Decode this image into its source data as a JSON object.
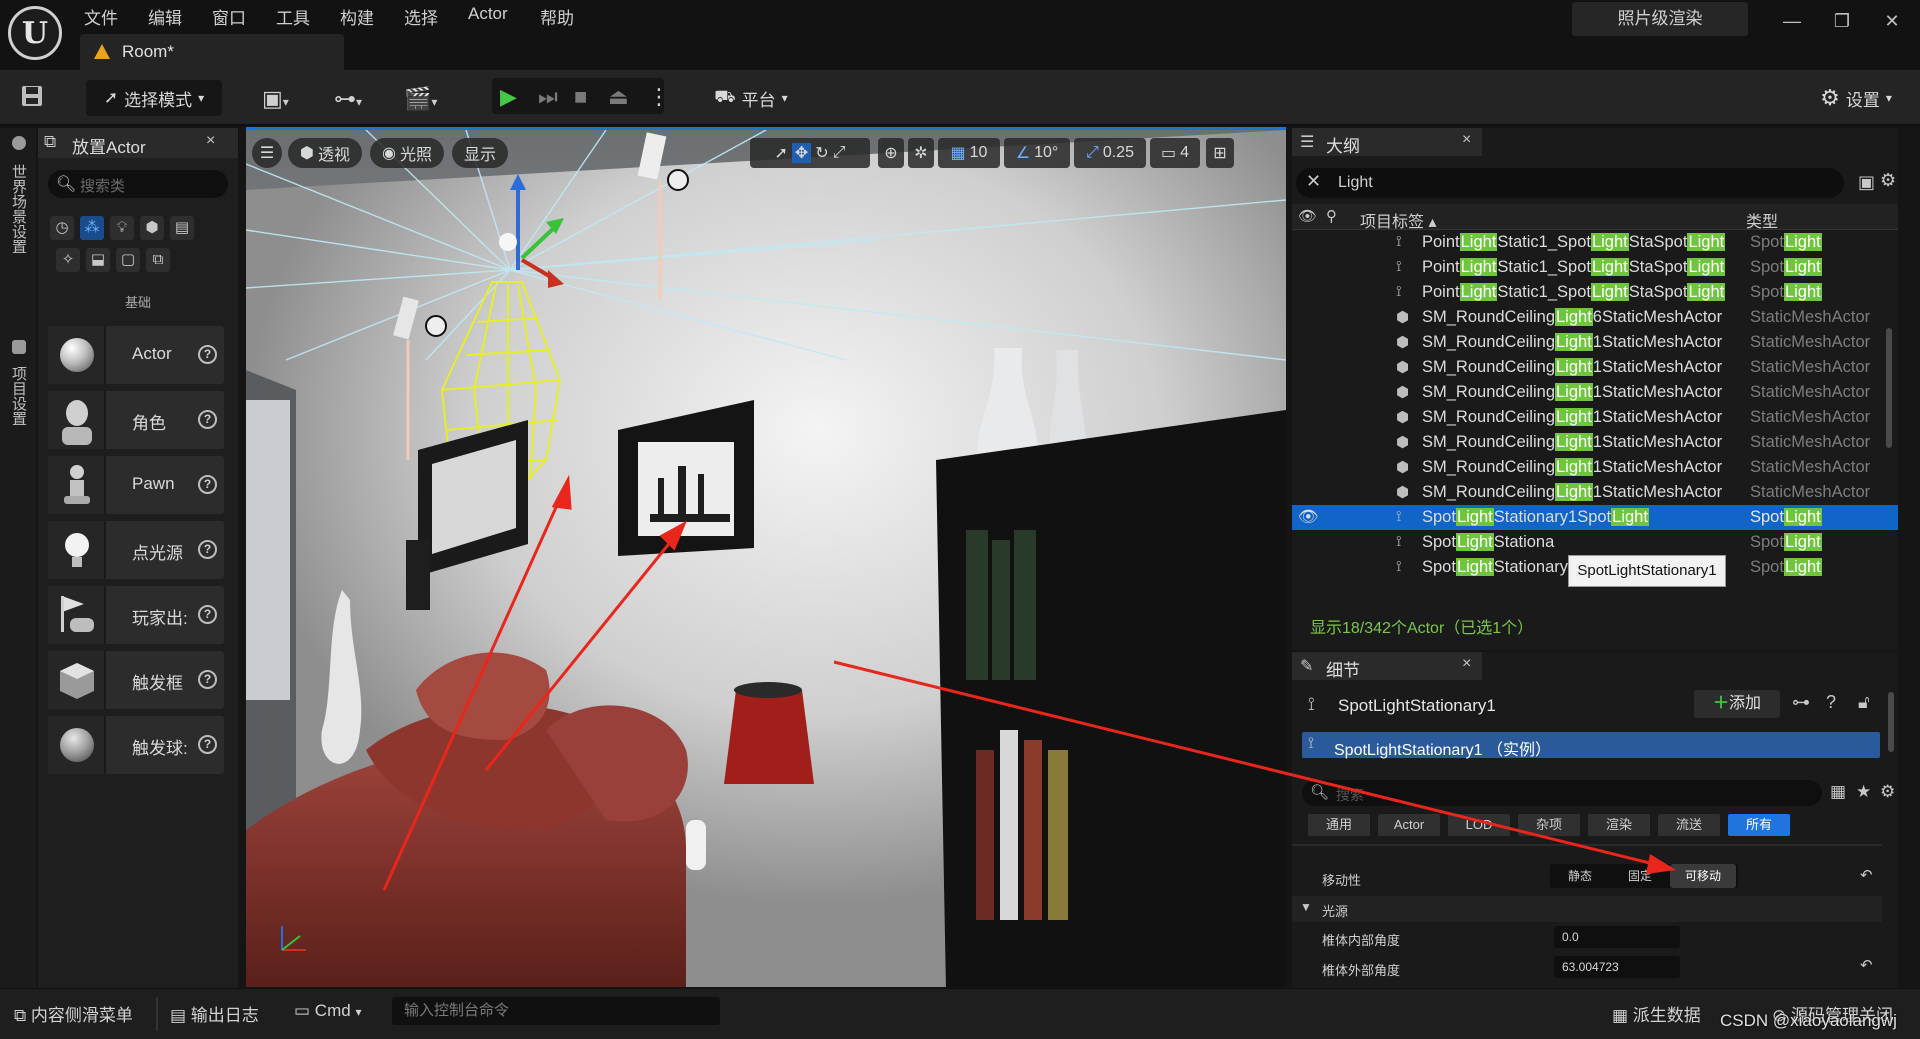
{
  "menu": {
    "items": [
      "文件",
      "编辑",
      "窗口",
      "工具",
      "构建",
      "选择",
      "Actor",
      "帮助"
    ],
    "render_mode": "照片级渲染",
    "logo_letter": "U",
    "window_controls": [
      "—",
      "❐",
      "✕"
    ]
  },
  "doc_tab": {
    "name": "Room*"
  },
  "toolbar": {
    "select_mode": "选择模式",
    "platform": "平台",
    "settings": "设置"
  },
  "left_strip": {
    "item1": "世界场景设置",
    "item2": "项目设置"
  },
  "place_panel": {
    "title": "放置Actor",
    "search_placeholder": "搜索类",
    "category": "基础",
    "items": [
      {
        "label": "Actor"
      },
      {
        "label": "角色"
      },
      {
        "label": "Pawn"
      },
      {
        "label": "点光源"
      },
      {
        "label": "玩家出:"
      },
      {
        "label": "触发框"
      },
      {
        "label": "触发球:"
      }
    ]
  },
  "viewport": {
    "perspective": "透视",
    "lit": "光照",
    "show": "显示",
    "grid_snap": "10",
    "rotation_snap": "10°",
    "scale_snap": "0.25",
    "camera_speed": "4"
  },
  "outliner": {
    "title": "大纲",
    "filter": "Light",
    "col_label": "项目标签",
    "col_type": "类型",
    "rows": [
      {
        "pre": "Point",
        "hl": "Light",
        "post": "Static1_Spot",
        "hl2": "Light",
        "post2": "StaSpot",
        "hl3": "Light",
        "type_pre": "Spot",
        "type_hl": "Light"
      },
      {
        "pre": "Point",
        "hl": "Light",
        "post": "Static1_Spot",
        "hl2": "Light",
        "post2": "StaSpot",
        "hl3": "Light",
        "type_pre": "Spot",
        "type_hl": "Light"
      },
      {
        "pre": "Point",
        "hl": "Light",
        "post": "Static1_Spot",
        "hl2": "Light",
        "post2": "StaSpot",
        "hl3": "Light",
        "type_pre": "Spot",
        "type_hl": "Light"
      },
      {
        "pre": "SM_RoundCeiling",
        "hl": "Light",
        "post": "6StaticMeshActor",
        "type": "StaticMeshActor"
      },
      {
        "pre": "SM_RoundCeiling",
        "hl": "Light",
        "post": "1StaticMeshActor",
        "type": "StaticMeshActor"
      },
      {
        "pre": "SM_RoundCeiling",
        "hl": "Light",
        "post": "1StaticMeshActor",
        "type": "StaticMeshActor"
      },
      {
        "pre": "SM_RoundCeiling",
        "hl": "Light",
        "post": "1StaticMeshActor",
        "type": "StaticMeshActor"
      },
      {
        "pre": "SM_RoundCeiling",
        "hl": "Light",
        "post": "1StaticMeshActor",
        "type": "StaticMeshActor"
      },
      {
        "pre": "SM_RoundCeiling",
        "hl": "Light",
        "post": "1StaticMeshActor",
        "type": "StaticMeshActor"
      },
      {
        "pre": "SM_RoundCeiling",
        "hl": "Light",
        "post": "1StaticMeshActor",
        "type": "StaticMeshActor"
      },
      {
        "pre": "SM_RoundCeiling",
        "hl": "Light",
        "post": "1StaticMeshActor",
        "type": "StaticMeshActor"
      },
      {
        "pre": "Spot",
        "hl": "Light",
        "post": "Stationary1",
        "mid": "Spot",
        "hl3": "Light",
        "type_pre": "Spot",
        "type_hl": "Light",
        "selected": true
      },
      {
        "pre": "Spot",
        "hl": "Light",
        "post": "Stationa",
        "type_pre": "Spot",
        "type_hl": "Light"
      },
      {
        "pre": "Spot",
        "hl": "Light",
        "post": "Stationary",
        "type_pre": "Spot",
        "type_hl": "Light"
      }
    ],
    "footer": "显示18/342个Actor（已选1个）",
    "tooltip": "SpotLightStationary1"
  },
  "details": {
    "title": "细节",
    "actor_name": "SpotLightStationary1",
    "add_button": "添加",
    "component": "SpotLightStationary1 （实例）",
    "search_placeholder": "搜索",
    "tabs": [
      "通用",
      "Actor",
      "LOD",
      "杂项",
      "渲染",
      "流送",
      "所有"
    ],
    "mobility_label": "移动性",
    "mobility_options": [
      "静态",
      "固定",
      "可移动"
    ],
    "section_light": "光源",
    "inner_cone_label": "椎体内部角度",
    "inner_cone_value": "0.0",
    "outer_cone_label": "椎体外部角度",
    "outer_cone_value": "63.004723"
  },
  "statusbar": {
    "content_drawer": "内容侧滑菜单",
    "output_log": "输出日志",
    "cmd": "Cmd",
    "console_placeholder": "输入控制台命令",
    "derived_data": "派生数据",
    "source_control": "源码管理关闭",
    "watermark": "CSDN @xiaoyaolangwj"
  },
  "colors": {
    "accent_blue": "#1165c8",
    "highlight_green": "#6fc63d",
    "annotation_red": "#e8261c",
    "cone_yellow": "#e6ee2a"
  }
}
